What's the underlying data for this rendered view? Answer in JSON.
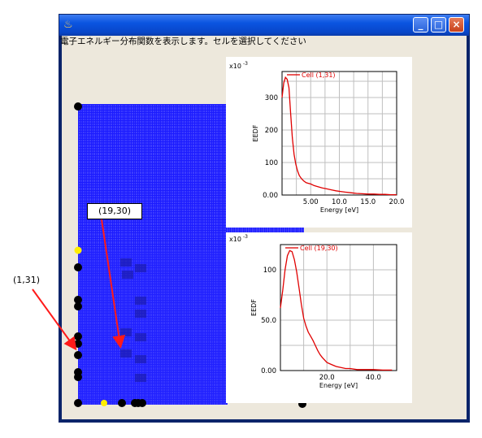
{
  "window": {
    "title": "",
    "icon": "java-cup-icon",
    "buttons": {
      "minimize": "_",
      "maximize": "□",
      "close": "×"
    }
  },
  "instruction": "電子エネルギー分布関数を表示します。セルを選択してください",
  "callouts": {
    "cell_a": "(19,30)",
    "cell_b": "(1,31)"
  },
  "colors": {
    "grid": "#1c1cff",
    "curve": "#e00000",
    "marker_black": "#000000",
    "marker_yellow": "#ffee00"
  },
  "chart_data": [
    {
      "type": "line",
      "xlabel": "Energy  [eV]",
      "ylabel": "EEDF",
      "exponent_label": "x10",
      "exponent": "-3",
      "legend": "Cell (1,31)",
      "xlim": [
        0,
        20
      ],
      "ylim": [
        0,
        380
      ],
      "x_ticks": [
        "5.00",
        "10.0",
        "15.0",
        "20.0"
      ],
      "y_ticks": [
        "0.00",
        "100",
        "200",
        "300"
      ],
      "series": [
        {
          "name": "Cell (1,31)",
          "x": [
            0,
            0.3,
            0.6,
            0.9,
            1.2,
            1.5,
            1.8,
            2.1,
            2.4,
            2.7,
            3.0,
            3.4,
            3.8,
            4.2,
            4.6,
            5.0,
            5.6,
            6.2,
            7.0,
            7.8,
            8.6,
            9.4,
            10.2,
            11.0,
            12.0,
            13.0,
            14.0,
            15.0,
            16.0,
            17.0,
            18.0,
            19.0,
            20.0
          ],
          "y": [
            300,
            345,
            362,
            356,
            330,
            250,
            175,
            125,
            95,
            75,
            60,
            50,
            43,
            38,
            36,
            34,
            29,
            26,
            22,
            19,
            16,
            13,
            11,
            9,
            7,
            5,
            4,
            3,
            3,
            2,
            2,
            1,
            1
          ]
        }
      ]
    },
    {
      "type": "line",
      "xlabel": "Energy  [eV]",
      "ylabel": "EEDF",
      "exponent_label": "x10",
      "exponent": "-3",
      "legend": "Cell (19,30)",
      "xlim": [
        0,
        50
      ],
      "ylim": [
        0,
        125
      ],
      "x_ticks": [
        "20.0",
        "40.0"
      ],
      "y_ticks": [
        "0.00",
        "50.0",
        "100"
      ],
      "series": [
        {
          "name": "Cell (19,30)",
          "x": [
            0,
            1,
            2,
            3,
            4,
            5,
            6,
            7,
            8,
            9,
            10,
            11,
            12,
            13,
            14,
            15,
            16,
            17,
            18,
            20,
            22,
            24,
            26,
            28,
            30,
            33,
            36,
            40,
            44,
            48
          ],
          "y": [
            62,
            80,
            100,
            114,
            119,
            118,
            110,
            98,
            82,
            66,
            52,
            44,
            38,
            34,
            30,
            25,
            20,
            16,
            13,
            8,
            6,
            4,
            3,
            2,
            2,
            1,
            1,
            1,
            0.5,
            0.5
          ]
        }
      ]
    }
  ]
}
